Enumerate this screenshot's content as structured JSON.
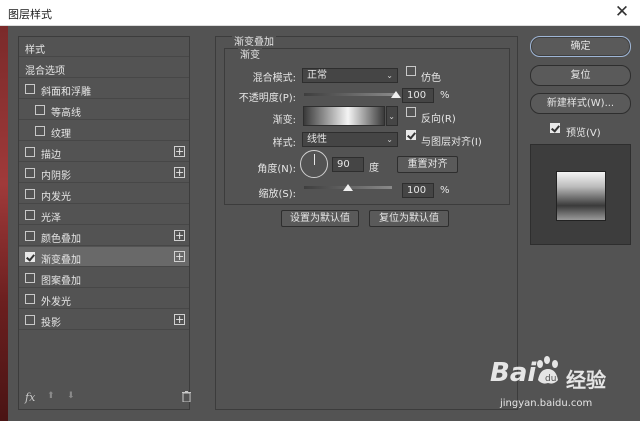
{
  "window": {
    "title": "图层样式",
    "close_glyph": "✕"
  },
  "left_panel": {
    "items": [
      {
        "label": "样式",
        "has_checkbox": false,
        "checked": false,
        "indent": 0,
        "has_plus": false,
        "selected": false
      },
      {
        "label": "混合选项",
        "has_checkbox": false,
        "checked": false,
        "indent": 0,
        "has_plus": false,
        "selected": false
      },
      {
        "label": "斜面和浮雕",
        "has_checkbox": true,
        "checked": false,
        "indent": 0,
        "has_plus": false,
        "selected": false
      },
      {
        "label": "等高线",
        "has_checkbox": true,
        "checked": false,
        "indent": 1,
        "has_plus": false,
        "selected": false
      },
      {
        "label": "纹理",
        "has_checkbox": true,
        "checked": false,
        "indent": 1,
        "has_plus": false,
        "selected": false
      },
      {
        "label": "描边",
        "has_checkbox": true,
        "checked": false,
        "indent": 0,
        "has_plus": true,
        "selected": false
      },
      {
        "label": "内阴影",
        "has_checkbox": true,
        "checked": false,
        "indent": 0,
        "has_plus": true,
        "selected": false
      },
      {
        "label": "内发光",
        "has_checkbox": true,
        "checked": false,
        "indent": 0,
        "has_plus": false,
        "selected": false
      },
      {
        "label": "光泽",
        "has_checkbox": true,
        "checked": false,
        "indent": 0,
        "has_plus": false,
        "selected": false
      },
      {
        "label": "颜色叠加",
        "has_checkbox": true,
        "checked": false,
        "indent": 0,
        "has_plus": true,
        "selected": false
      },
      {
        "label": "渐变叠加",
        "has_checkbox": true,
        "checked": true,
        "indent": 0,
        "has_plus": true,
        "selected": true
      },
      {
        "label": "图案叠加",
        "has_checkbox": true,
        "checked": false,
        "indent": 0,
        "has_plus": false,
        "selected": false
      },
      {
        "label": "外发光",
        "has_checkbox": true,
        "checked": false,
        "indent": 0,
        "has_plus": false,
        "selected": false
      },
      {
        "label": "投影",
        "has_checkbox": true,
        "checked": false,
        "indent": 0,
        "has_plus": true,
        "selected": false
      }
    ],
    "plus_glyph": "+",
    "footer": {
      "fx_label": "fx",
      "up_glyph": "⬆",
      "down_glyph": "⬇",
      "trash_icon": "trash-icon"
    }
  },
  "gradient_overlay": {
    "section_title": "渐变叠加",
    "subsection_title": "渐变",
    "blend_mode_label": "混合模式:",
    "blend_mode_value": "正常",
    "dither_label": "仿色",
    "dither_checked": false,
    "opacity_label": "不透明度(P):",
    "opacity_value": "100",
    "opacity_unit": "%",
    "opacity_fraction": 1.0,
    "gradient_label": "渐变:",
    "reverse_label": "反向(R)",
    "reverse_checked": false,
    "style_label": "样式:",
    "style_value": "线性",
    "align_label": "与图层对齐(I)",
    "align_checked": true,
    "angle_label": "角度(N):",
    "angle_value": "90",
    "angle_unit": "度",
    "reset_align_label": "重置对齐",
    "scale_label": "缩放(S):",
    "scale_value": "100",
    "scale_unit": "%",
    "scale_fraction": 0.5,
    "set_default_label": "设置为默认值",
    "reset_default_label": "复位为默认值",
    "arrow_glyph": "⌄"
  },
  "right_panel": {
    "ok_label": "确定",
    "reset_label": "复位",
    "new_style_label": "新建样式(W)...",
    "preview_label": "预览(V)",
    "preview_checked": true
  },
  "colors": {
    "gradient_stops": [
      "#3a3a3a",
      "#f4f4f4",
      "#3a3a3a"
    ],
    "accent_focus": "#9fb6d6"
  },
  "watermark": {
    "text": "Bai",
    "brand": "经验",
    "url": "jingyan.baidu.com"
  }
}
